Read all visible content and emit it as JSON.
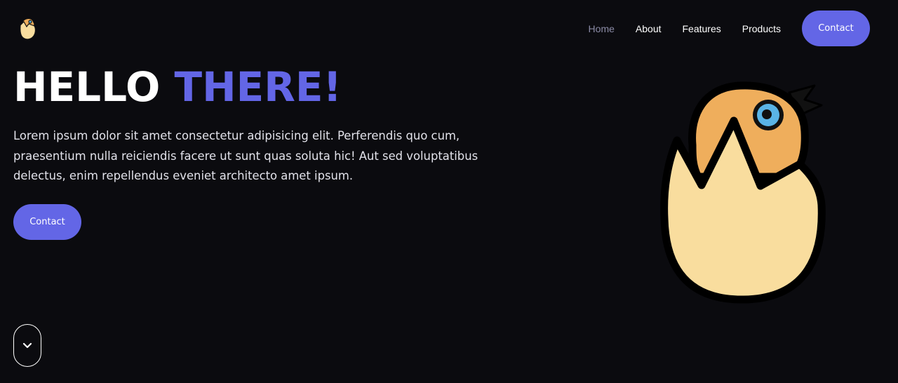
{
  "nav": {
    "links": [
      {
        "label": "Home",
        "active": true
      },
      {
        "label": "About",
        "active": false
      },
      {
        "label": "Features",
        "active": false
      },
      {
        "label": "Products",
        "active": false
      }
    ],
    "contact_label": "Contact"
  },
  "hero": {
    "title_part1": "HELLO",
    "title_part2": "THERE!",
    "text": "Lorem ipsum dolor sit amet consectetur adipisicing elit. Perferendis quo cum, praesentium nulla reiciendis facere ut sunt quas soluta hic! Aut sed voluptatibus delectus, enim repellendus eveniet architecto amet ipsum.",
    "contact_label": "Contact"
  },
  "icons": {
    "logo": "chick-in-egg-logo",
    "scroll": "chevron-down-icon",
    "illustration": "chick-in-egg-illustration"
  },
  "colors": {
    "background": "#0b0b0f",
    "accent": "#6366e6",
    "muted_nav": "#8b8ba6",
    "egg": "#f9dd9e",
    "chick": "#efae5c",
    "eye": "#5ab4e6"
  }
}
